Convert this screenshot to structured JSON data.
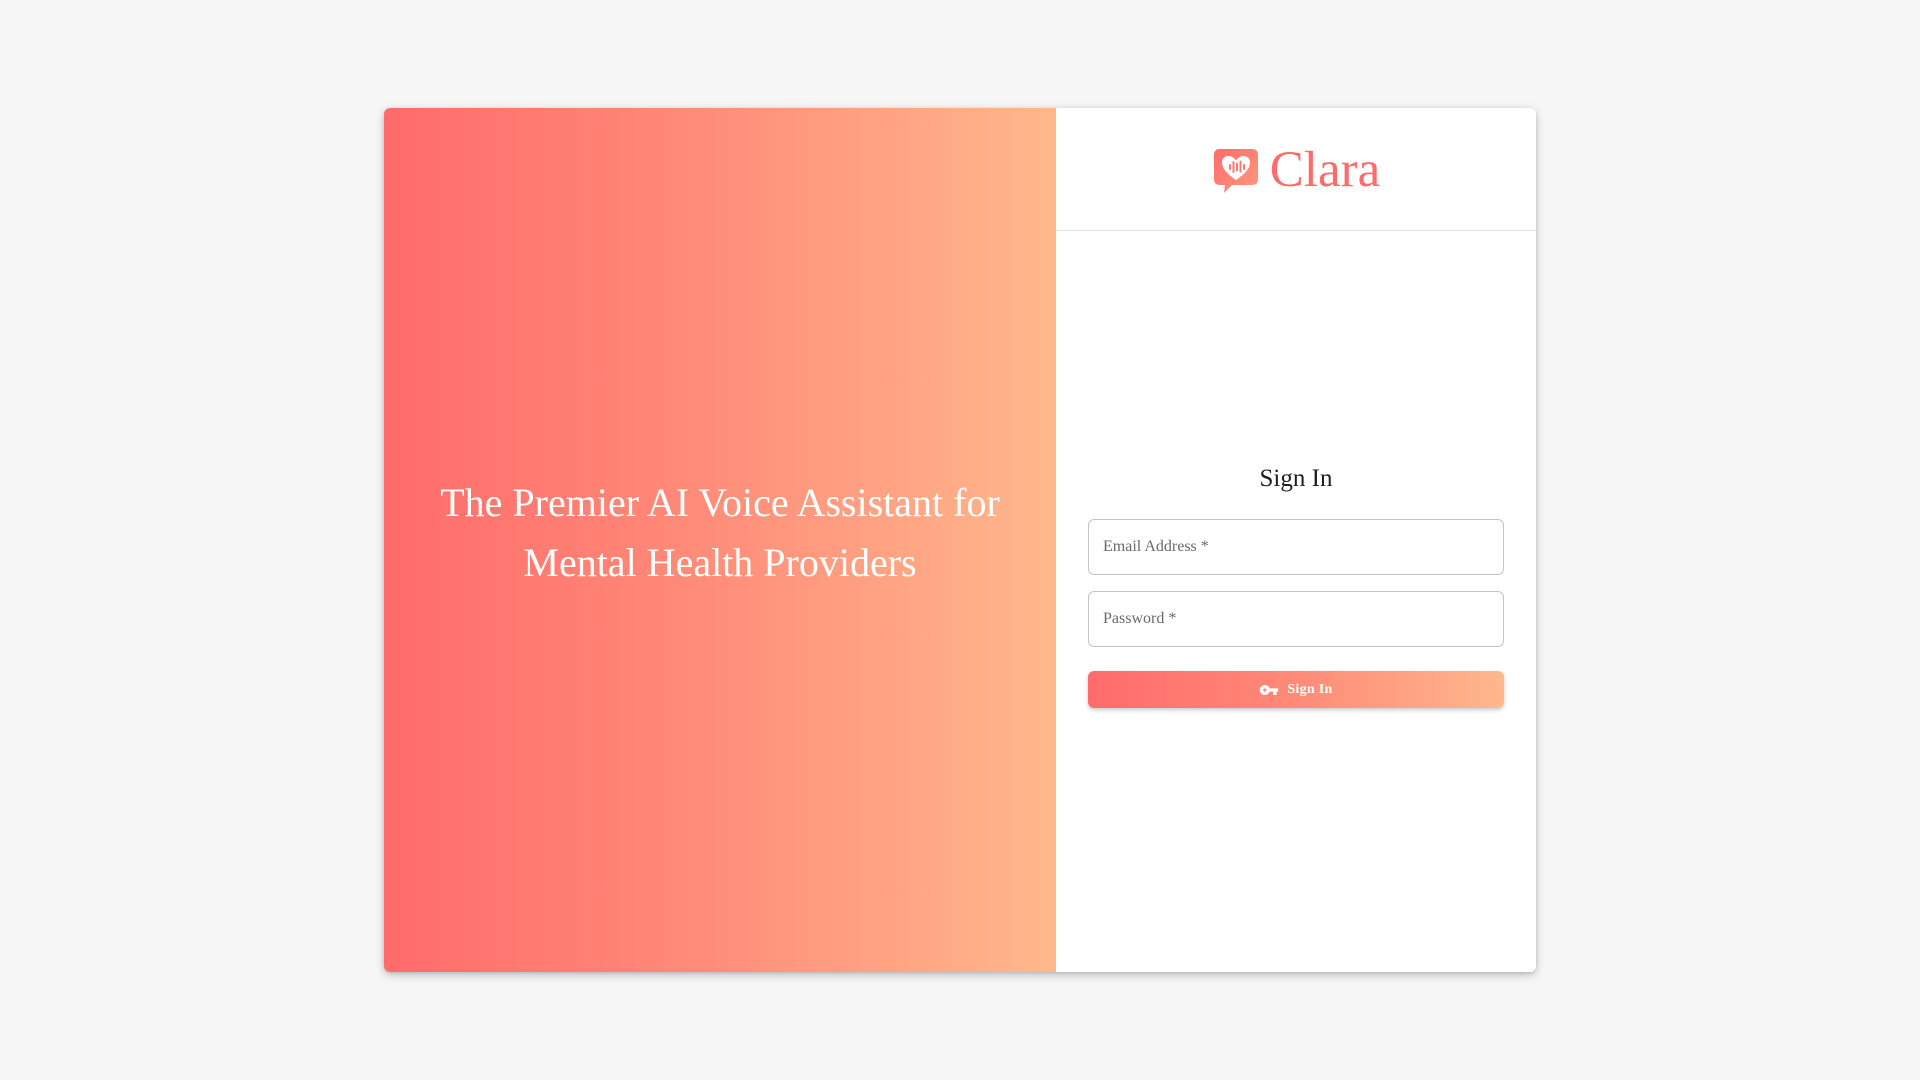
{
  "hero": {
    "tagline": "The Premier AI Voice Assistant for Mental Health Providers"
  },
  "brand": {
    "name": "Clara",
    "icon": "heart-speech-bubble-icon",
    "color": "#ff6b6b",
    "gradient_start": "#ff6b6b",
    "gradient_end": "#ffb88c"
  },
  "form": {
    "title": "Sign In",
    "email": {
      "placeholder": "Email Address *",
      "value": ""
    },
    "password": {
      "placeholder": "Password *",
      "value": ""
    },
    "submit": {
      "label": "Sign In",
      "icon": "key-icon"
    }
  }
}
